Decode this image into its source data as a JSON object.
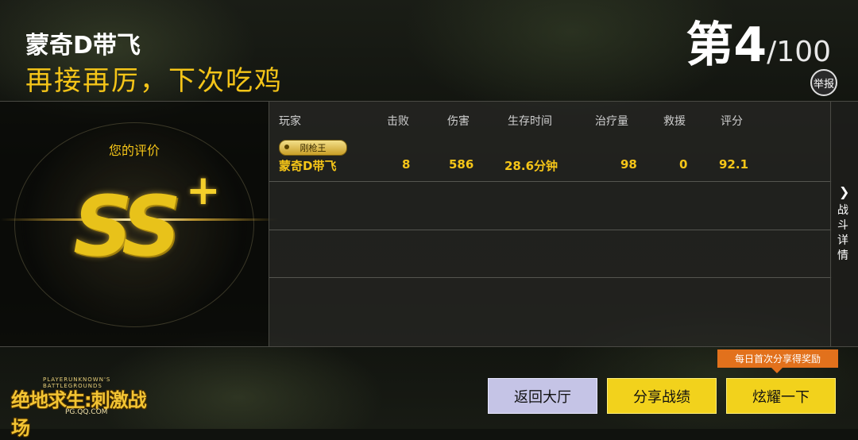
{
  "header": {
    "player_name": "蒙奇D带飞",
    "slogan": "再接再厉，下次吃鸡",
    "rank": "第4",
    "total": "/100",
    "report_label": "举报"
  },
  "grade": {
    "label": "您的评价",
    "value": "SS",
    "plus": "+"
  },
  "stats": {
    "columns": [
      "玩家",
      "击败",
      "伤害",
      "生存时间",
      "治疗量",
      "救援",
      "评分"
    ],
    "rows": [
      {
        "title_badge": "刚枪王",
        "player": "蒙奇D带飞",
        "kills": "8",
        "damage": "586",
        "survival": "28.6分钟",
        "healing": "98",
        "rescues": "0",
        "score": "92.1"
      }
    ]
  },
  "side_tab": {
    "label": "战斗详情"
  },
  "logo": {
    "top_text": "PLAYERUNKNOWN'S BATTLEGROUNDS",
    "main_text": "绝地求生:刺激战场",
    "url": "PG.QQ.COM"
  },
  "buttons": {
    "lobby": "返回大厅",
    "share": "分享战绩",
    "show_off": "炫耀一下",
    "promo": "每日首次分享得奖励"
  },
  "colors": {
    "accent_gold": "#f5c518",
    "promo_orange": "#e2711c",
    "lobby_button": "#c5c4e6"
  }
}
